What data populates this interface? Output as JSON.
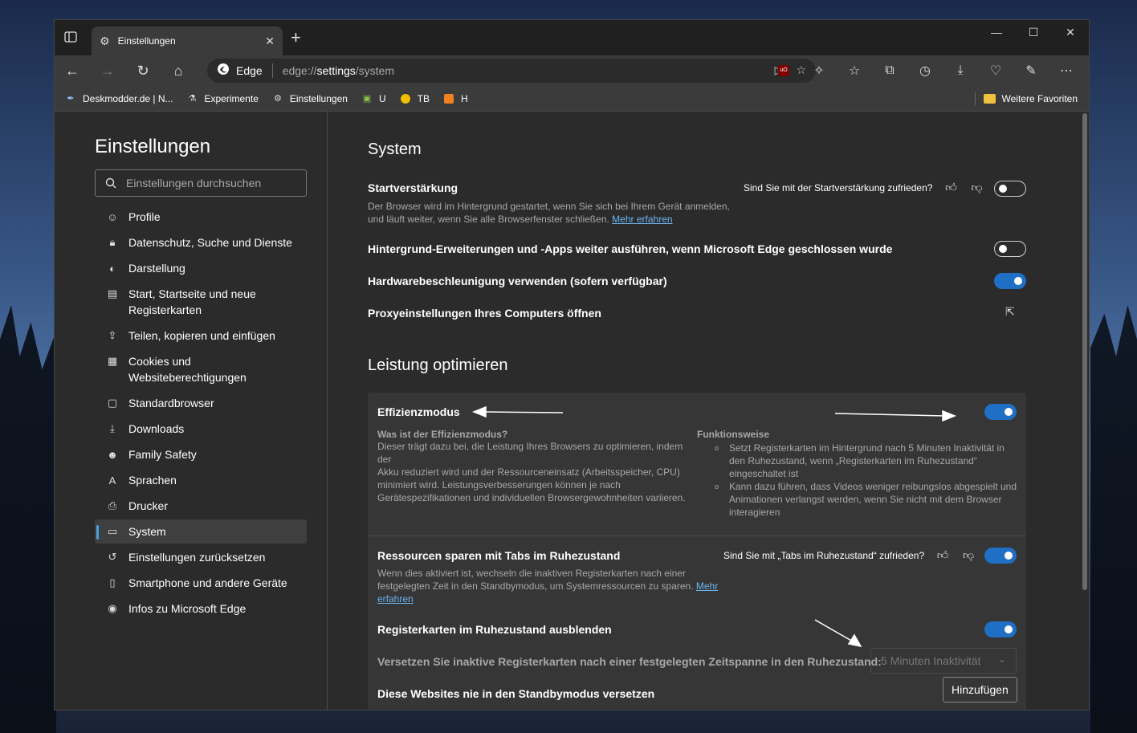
{
  "tab": {
    "title": "Einstellungen"
  },
  "addressbar": {
    "site": "Edge",
    "url_prefix": "edge://",
    "url_bold": "settings",
    "url_suffix": "/system"
  },
  "favorites": [
    {
      "label": "Deskmodder.de | N...",
      "icon": "pen-icon"
    },
    {
      "label": "Experimente",
      "icon": "flask-icon"
    },
    {
      "label": "Einstellungen",
      "icon": "gear-icon"
    },
    {
      "label": "U",
      "icon": "folder-icon"
    },
    {
      "label": "TB",
      "icon": "coin-icon"
    },
    {
      "label": "H",
      "icon": "box-icon"
    }
  ],
  "favorites_more": "Weitere Favoriten",
  "sidebar": {
    "title": "Einstellungen",
    "search_placeholder": "Einstellungen durchsuchen",
    "items": [
      {
        "label": "Profile",
        "icon": "profile-icon"
      },
      {
        "label": "Datenschutz, Suche und Dienste",
        "icon": "lock-icon"
      },
      {
        "label": "Darstellung",
        "icon": "palette-icon"
      },
      {
        "label": "Start, Startseite und neue Registerkarten",
        "icon": "home-grid-icon"
      },
      {
        "label": "Teilen, kopieren und einfügen",
        "icon": "share-icon"
      },
      {
        "label": "Cookies und Websiteberechtigungen",
        "icon": "cookie-icon"
      },
      {
        "label": "Standardbrowser",
        "icon": "browser-icon"
      },
      {
        "label": "Downloads",
        "icon": "download-icon"
      },
      {
        "label": "Family Safety",
        "icon": "family-icon"
      },
      {
        "label": "Sprachen",
        "icon": "language-icon"
      },
      {
        "label": "Drucker",
        "icon": "printer-icon"
      },
      {
        "label": "System",
        "icon": "laptop-icon"
      },
      {
        "label": "Einstellungen zurücksetzen",
        "icon": "reset-icon"
      },
      {
        "label": "Smartphone und andere Geräte",
        "icon": "phone-icon"
      },
      {
        "label": "Infos zu Microsoft Edge",
        "icon": "edge-icon"
      }
    ],
    "active": "System"
  },
  "system": {
    "title": "System",
    "startup": {
      "title": "Startverstärkung",
      "desc_line1": "Der Browser wird im Hintergrund gestartet, wenn Sie sich bei Ihrem Gerät anmelden,",
      "desc_line2": "und läuft weiter, wenn Sie alle Browserfenster schließen.",
      "link": "Mehr erfahren",
      "feedback": "Sind Sie mit der Startverstärkung zufrieden?",
      "toggle": false
    },
    "background": {
      "title": "Hintergrund-Erweiterungen und -Apps weiter ausführen, wenn Microsoft Edge geschlossen wurde",
      "toggle": false
    },
    "hardware": {
      "title": "Hardwarebeschleunigung verwenden (sofern verfügbar)",
      "toggle": true
    },
    "proxy": {
      "title": "Proxyeinstellungen Ihres Computers öffnen"
    }
  },
  "performance": {
    "title": "Leistung optimieren",
    "efficiency": {
      "title": "Effizienzmodus",
      "toggle": true,
      "what_title": "Was ist der Effizienzmodus?",
      "what_lines": [
        "Dieser trägt dazu bei, die Leistung Ihres Browsers zu optimieren, indem der",
        "Akku reduziert wird und der Ressourceneinsatz (Arbeitsspeicher, CPU)",
        "minimiert wird. Leistungsverbesserungen können je nach",
        "Gerätespezifikationen und individuellen Browsergewohnheiten variieren."
      ],
      "how_title": "Funktionsweise",
      "how_bullets": [
        [
          "Setzt Registerkarten im Hintergrund nach 5 Minuten Inaktivität in",
          "den Ruhezustand, wenn „Registerkarten im Ruhezustand“",
          "eingeschaltet ist"
        ],
        [
          "Kann dazu führen, dass Videos weniger reibungslos abgespielt und",
          "Animationen verlangst werden, wenn Sie nicht mit dem Browser",
          "interagieren"
        ]
      ]
    },
    "sleeping": {
      "title": "Ressourcen sparen mit Tabs im Ruhezustand",
      "desc_line1": "Wenn dies aktiviert ist, wechseln die inaktiven Registerkarten nach einer",
      "desc_line2": "festgelegten Zeit in den Standbymodus, um Systemressourcen zu sparen.",
      "link_part1": "Mehr",
      "link_part2": "erfahren",
      "feedback": "Sind Sie mit „Tabs im Ruhezustand“ zufrieden?",
      "toggle": true
    },
    "hide_sleeping": {
      "title": "Registerkarten im Ruhezustand ausblenden",
      "toggle": true
    },
    "timeout": {
      "label": "Versetzen Sie inaktive Registerkarten nach einer festgelegten Zeitspanne in den Ruhezustand:",
      "value": "5 Minuten Inaktivität"
    },
    "never_sleep": {
      "title": "Diese Websites nie in den Standbymodus versetzen",
      "button": "Hinzufügen"
    }
  },
  "colors": {
    "accent": "#1f6fc5",
    "link": "#6cb4f0",
    "background": "#2b2b2b",
    "card": "#363636"
  }
}
